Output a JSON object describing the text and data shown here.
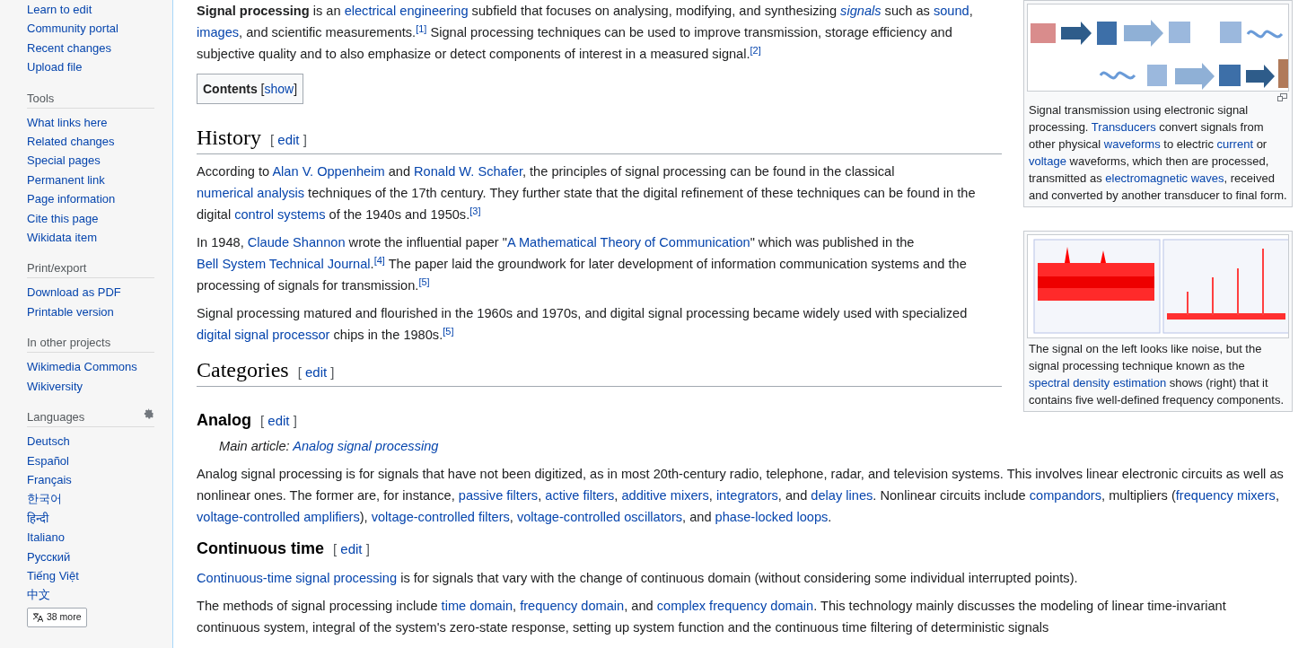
{
  "sidebar": {
    "sections": [
      {
        "items": [
          "Learn to edit",
          "Community portal",
          "Recent changes",
          "Upload file"
        ]
      },
      {
        "heading": "Tools",
        "items": [
          "What links here",
          "Related changes",
          "Special pages",
          "Permanent link",
          "Page information",
          "Cite this page",
          "Wikidata item"
        ]
      },
      {
        "heading": "Print/export",
        "items": [
          "Download as PDF",
          "Printable version"
        ]
      },
      {
        "heading": "In other projects",
        "items": [
          "Wikimedia Commons",
          "Wikiversity"
        ]
      },
      {
        "heading": "Languages",
        "settings": true,
        "items": [
          "Deutsch",
          "Español",
          "Français",
          "한국어",
          "हिन्दी",
          "Italiano",
          "Русский",
          "Tiếng Việt",
          "中文"
        ],
        "more_button": "38 more"
      }
    ]
  },
  "figures": [
    {
      "kind": "picture",
      "magnify": true,
      "caption": [
        {
          "text": "Signal transmission using electronic signal processing. "
        },
        {
          "text": "Transducers",
          "kind": "link"
        },
        {
          "text": " convert signals from other physical "
        },
        {
          "text": "waveforms",
          "kind": "link"
        },
        {
          "text": " to electric "
        },
        {
          "text": "current",
          "kind": "link"
        },
        {
          "text": " or "
        },
        {
          "text": "voltage",
          "kind": "link"
        },
        {
          "text": " waveforms, which then are processed, transmitted as "
        },
        {
          "text": "electromagnetic waves",
          "kind": "link"
        },
        {
          "text": ", received and converted by another transducer to final form."
        }
      ]
    },
    {
      "kind": "picture",
      "magnify": false,
      "caption": [
        {
          "text": "The signal on the left looks like noise, but the signal processing technique known as the "
        },
        {
          "text": "spectral density estimation",
          "kind": "link"
        },
        {
          "text": " shows (right) that it contains five well-defined frequency components."
        }
      ]
    }
  ],
  "article": [
    {
      "kind": "paragraph",
      "segments": [
        {
          "text": "Signal processing",
          "kind": "bold"
        },
        {
          "text": " is an "
        },
        {
          "text": "electrical engineering",
          "kind": "link"
        },
        {
          "text": " subfield that focuses on analysing, modifying, and synthesizing "
        },
        {
          "text": "signals",
          "kind": "italic_link"
        },
        {
          "text": " such as "
        },
        {
          "text": "sound",
          "kind": "link"
        },
        {
          "text": ", "
        },
        {
          "text": "images",
          "kind": "link"
        },
        {
          "text": ", and scientific measurements."
        },
        {
          "text": "[1]",
          "kind": "ref"
        },
        {
          "text": " Signal processing techniques can be used to improve transmission, storage efficiency and subjective quality and to also emphasize or detect components of interest in a measured signal."
        },
        {
          "text": "[2]",
          "kind": "ref"
        }
      ]
    },
    {
      "kind": "toc",
      "segments": [
        {
          "text": "Contents",
          "kind": "bold"
        },
        {
          "text": " ["
        },
        {
          "text": "show",
          "kind": "link"
        },
        {
          "text": "]"
        }
      ]
    },
    {
      "kind": "h2",
      "title": "History",
      "edit": [
        {
          "text": "[ "
        },
        {
          "text": "edit",
          "kind": "link"
        },
        {
          "text": " ]"
        }
      ]
    },
    {
      "kind": "paragraph",
      "segments": [
        {
          "text": "According to "
        },
        {
          "text": "Alan V. Oppenheim",
          "kind": "link"
        },
        {
          "text": " and "
        },
        {
          "text": "Ronald W. Schafer",
          "kind": "link"
        },
        {
          "text": ", the principles of signal processing can be found in the classical "
        },
        {
          "text": "numerical analysis",
          "kind": "link"
        },
        {
          "text": " techniques of the 17th century. They further state that the digital refinement of these techniques can be found in the digital "
        },
        {
          "text": "control systems",
          "kind": "link"
        },
        {
          "text": " of the 1940s and 1950s."
        },
        {
          "text": "[3]",
          "kind": "ref"
        }
      ]
    },
    {
      "kind": "paragraph",
      "segments": [
        {
          "text": "In 1948, "
        },
        {
          "text": "Claude Shannon",
          "kind": "link"
        },
        {
          "text": " wrote the influential paper \""
        },
        {
          "text": "A Mathematical Theory of Communication",
          "kind": "link"
        },
        {
          "text": "\" which was published in the "
        },
        {
          "text": "Bell System Technical Journal",
          "kind": "link"
        },
        {
          "text": "."
        },
        {
          "text": "[4]",
          "kind": "ref"
        },
        {
          "text": " The paper laid the groundwork for later development of information communication systems and the processing of signals for transmission."
        },
        {
          "text": "[5]",
          "kind": "ref"
        }
      ]
    },
    {
      "kind": "paragraph",
      "segments": [
        {
          "text": "Signal processing matured and flourished in the 1960s and 1970s, and digital signal processing became widely used with specialized "
        },
        {
          "text": "digital signal processor",
          "kind": "link"
        },
        {
          "text": " chips in the 1980s."
        },
        {
          "text": "[5]",
          "kind": "ref"
        }
      ]
    },
    {
      "kind": "h2",
      "title": "Categories",
      "edit": [
        {
          "text": "[ "
        },
        {
          "text": "edit",
          "kind": "link"
        },
        {
          "text": " ]"
        }
      ]
    },
    {
      "kind": "h3",
      "title": "Analog",
      "edit": [
        {
          "text": "[ "
        },
        {
          "text": "edit",
          "kind": "link"
        },
        {
          "text": " ]"
        }
      ]
    },
    {
      "kind": "hatnote",
      "segments": [
        {
          "text": "Main article: "
        },
        {
          "text": "Analog signal processing",
          "kind": "link"
        }
      ]
    },
    {
      "kind": "paragraph",
      "segments": [
        {
          "text": "Analog signal processing is for signals that have not been digitized, as in most 20th-century radio, telephone, radar, and television systems. This involves linear electronic circuits as well as nonlinear ones. The former are, for instance, "
        },
        {
          "text": "passive filters",
          "kind": "link"
        },
        {
          "text": ", "
        },
        {
          "text": "active filters",
          "kind": "link"
        },
        {
          "text": ", "
        },
        {
          "text": "additive mixers",
          "kind": "link"
        },
        {
          "text": ", "
        },
        {
          "text": "integrators",
          "kind": "link"
        },
        {
          "text": ", and "
        },
        {
          "text": "delay lines",
          "kind": "link"
        },
        {
          "text": ". Nonlinear circuits include "
        },
        {
          "text": "compandors",
          "kind": "link"
        },
        {
          "text": ", multipliers ("
        },
        {
          "text": "frequency mixers",
          "kind": "link"
        },
        {
          "text": ", "
        },
        {
          "text": "voltage-controlled amplifiers",
          "kind": "link"
        },
        {
          "text": "), "
        },
        {
          "text": "voltage-controlled filters",
          "kind": "link"
        },
        {
          "text": ", "
        },
        {
          "text": "voltage-controlled oscillators",
          "kind": "link"
        },
        {
          "text": ", and "
        },
        {
          "text": "phase-locked loops",
          "kind": "link"
        },
        {
          "text": "."
        }
      ]
    },
    {
      "kind": "h3",
      "title": "Continuous time",
      "edit": [
        {
          "text": "[ "
        },
        {
          "text": "edit",
          "kind": "link"
        },
        {
          "text": " ]"
        }
      ]
    },
    {
      "kind": "paragraph",
      "segments": [
        {
          "text": "Continuous-time signal processing",
          "kind": "link"
        },
        {
          "text": " is for signals that vary with the change of continuous domain (without considering some individual interrupted points)."
        }
      ]
    },
    {
      "kind": "paragraph",
      "segments": [
        {
          "text": "The methods of signal processing include "
        },
        {
          "text": "time domain",
          "kind": "link"
        },
        {
          "text": ", "
        },
        {
          "text": "frequency domain",
          "kind": "link"
        },
        {
          "text": ", and "
        },
        {
          "text": "complex frequency domain",
          "kind": "link"
        },
        {
          "text": ". This technology mainly discusses the modeling of linear time-invariant continuous system, integral of the system's zero-state response, setting up system function and the continuous time filtering of deterministic signals"
        }
      ]
    }
  ]
}
